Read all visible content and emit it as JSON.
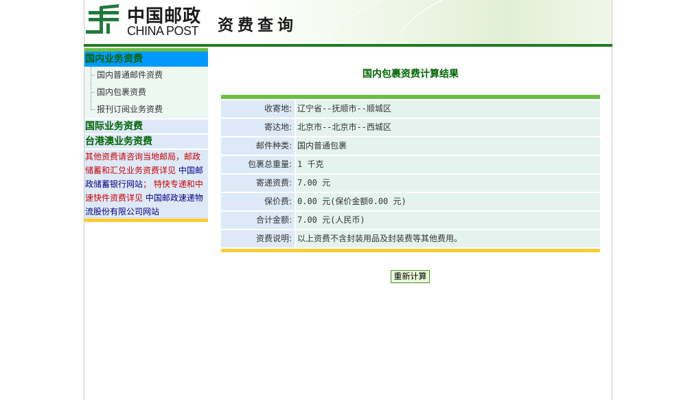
{
  "header": {
    "logo_cn": "中国邮政",
    "logo_en": "CHINA POST",
    "page_title": "资费查询"
  },
  "sidebar": {
    "domestic": {
      "label": "国内业务资费",
      "items": [
        {
          "label": "国内普通邮件资费"
        },
        {
          "label": "国内包裹资费"
        },
        {
          "label": "报刊订阅业务资费"
        }
      ]
    },
    "international": {
      "label": "国际业务资费"
    },
    "hk_macao_taiwan": {
      "label": "台港澳业务资费"
    },
    "info": {
      "part1": "其他资费请咨询当地邮局，邮政储蓄和汇兑业务资费详见",
      "link1": "中国邮政储蓄银行网站",
      "part2": "；  特快专递和中速快件资费详见",
      "link2": "中国邮政速递物流股份有限公司网站"
    }
  },
  "result": {
    "title": "国内包裹资费计算结果",
    "rows": [
      {
        "label": "收寄地:",
        "value": "辽宁省--抚顺市--顺城区"
      },
      {
        "label": "寄达地:",
        "value": "北京市--北京市--西城区"
      },
      {
        "label": "邮件种类:",
        "value": "国内普通包裹"
      },
      {
        "label": "包裹总重量:",
        "value": "1 千克"
      },
      {
        "label": "寄递资费:",
        "value": "7.00 元"
      },
      {
        "label": "保价费:",
        "value": "0.00 元(保价金额0.00 元)"
      },
      {
        "label": "合计金额:",
        "value": "7.00 元(人民币)"
      },
      {
        "label": "资费说明:",
        "value": "以上资费不含封装用品及封装费等其他费用。"
      }
    ]
  },
  "buttons": {
    "recalculate": "重新计算"
  },
  "colors": {
    "brand_green": "#1f7a1f",
    "accent_green": "#6cbd45",
    "accent_yellow": "#ffcc33",
    "active_blue": "#0099ff",
    "label_bg": "#dde9f7",
    "value_bg": "#e4f3ee"
  }
}
